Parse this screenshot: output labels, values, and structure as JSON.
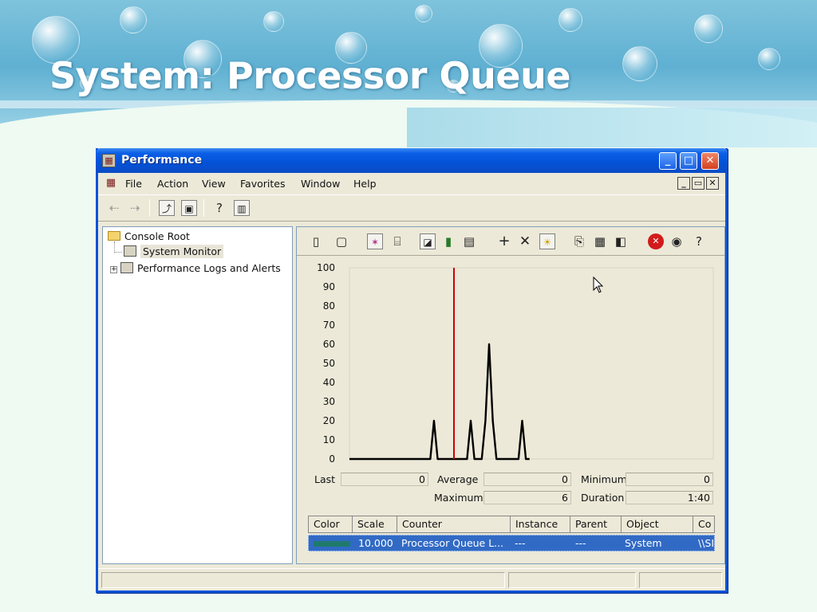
{
  "slide": {
    "title": "System: Processor Queue"
  },
  "window": {
    "title": "Performance",
    "controls": {
      "minimize": "_",
      "maximize": "□",
      "close": "✕"
    }
  },
  "menu": {
    "items": [
      "File",
      "Action",
      "View",
      "Favorites",
      "Window",
      "Help"
    ],
    "mdi": {
      "minimize": "_",
      "restore": "▭",
      "close": "✕"
    }
  },
  "toolbar": {
    "icons": [
      "back-arrow-icon",
      "forward-arrow-icon",
      "up-folder-icon",
      "show-hide-tree-icon",
      "help-icon",
      "show-hide-action-pane-icon"
    ]
  },
  "tree": {
    "root": "Console Root",
    "children": [
      "System Monitor",
      "Performance Logs and Alerts"
    ]
  },
  "monitor_toolbar": {
    "icons": [
      "new-counter-set-icon",
      "clear-display-icon",
      "view-current-activity-icon",
      "view-log-data-icon",
      "view-graph-icon",
      "view-histogram-icon",
      "view-report-icon",
      "add-counter-icon",
      "delete-counter-icon",
      "highlight-icon",
      "copy-properties-icon",
      "paste-counter-list-icon",
      "properties-icon",
      "freeze-display-icon",
      "update-data-icon",
      "help-icon"
    ]
  },
  "stats": {
    "last_label": "Last",
    "last_value": "0",
    "average_label": "Average",
    "average_value": "0",
    "minimum_label": "Minimum",
    "minimum_value": "0",
    "maximum_label": "Maximum",
    "maximum_value": "6",
    "duration_label": "Duration",
    "duration_value": "1:40"
  },
  "legend": {
    "columns": [
      "Color",
      "Scale",
      "Counter",
      "Instance",
      "Parent",
      "Object",
      "Co"
    ],
    "rows": [
      {
        "color": "#1f7a6d",
        "scale": "10.000",
        "counter": "Processor Queue L...",
        "instance": "---",
        "parent": "---",
        "object": "System",
        "computer": "\\\\SI"
      }
    ]
  },
  "colors": {
    "series": "#000000",
    "time_bar": "#cc0000",
    "selection": "#316ac5",
    "titlebar": "#0352d6"
  },
  "chart_data": {
    "type": "line",
    "title": "",
    "xlabel": "",
    "ylabel": "",
    "ylim": [
      0,
      100
    ],
    "yticks": [
      0,
      10,
      20,
      30,
      40,
      50,
      60,
      70,
      80,
      90,
      100
    ],
    "x_samples": 100,
    "current_time_index": 28,
    "series": [
      {
        "values": [
          0,
          0,
          0,
          0,
          0,
          0,
          0,
          0,
          0,
          0,
          0,
          0,
          0,
          0,
          0,
          0,
          0,
          0,
          0,
          0,
          0,
          0,
          0,
          20,
          0,
          0,
          0,
          0,
          0,
          0,
          0,
          0,
          0,
          20,
          0,
          0,
          0,
          20,
          60,
          20,
          0,
          0,
          0,
          0,
          0,
          0,
          0,
          20,
          0,
          0
        ]
      }
    ]
  }
}
